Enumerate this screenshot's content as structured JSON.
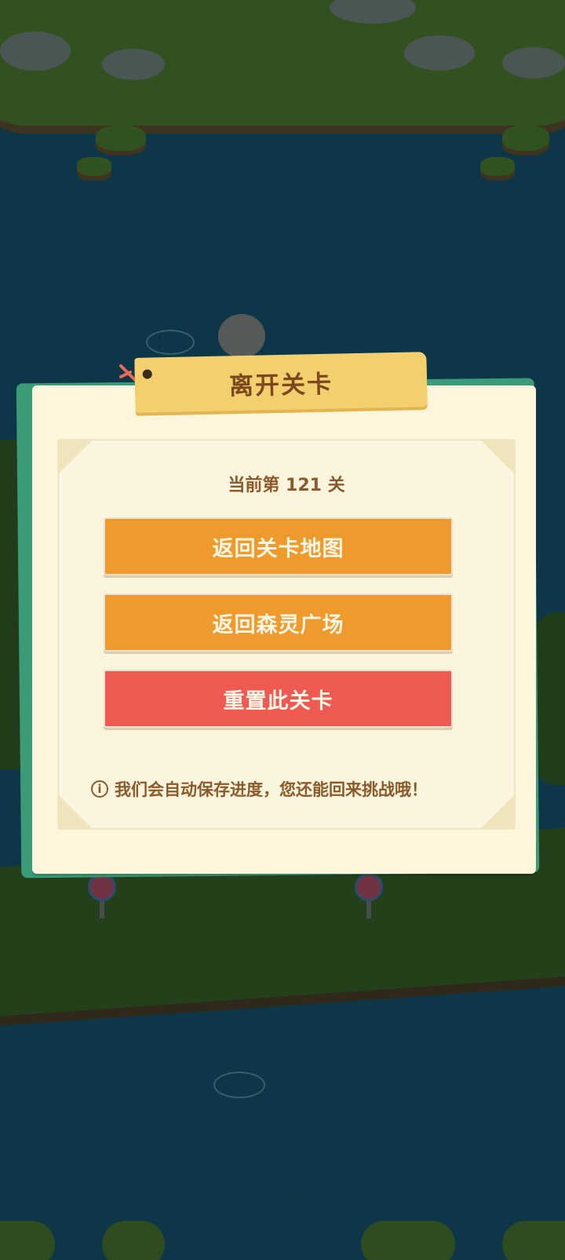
{
  "dialog": {
    "title": "离开关卡",
    "level_text": "当前第 121 关",
    "buttons": {
      "return_map": "返回关卡地图",
      "return_plaza": "返回森灵广场",
      "reset_level": "重置此关卡"
    },
    "note": "我们会自动保存进度，您还能回来挑战哦！",
    "info_icon_glyph": "i"
  },
  "colors": {
    "panel_bg": "#fdf6dc",
    "title_tag": "#f4cf6e",
    "button_orange": "#ee9a2c",
    "button_red": "#ee5a52",
    "text_brown": "#8b5a2b",
    "water": "#113f52"
  }
}
